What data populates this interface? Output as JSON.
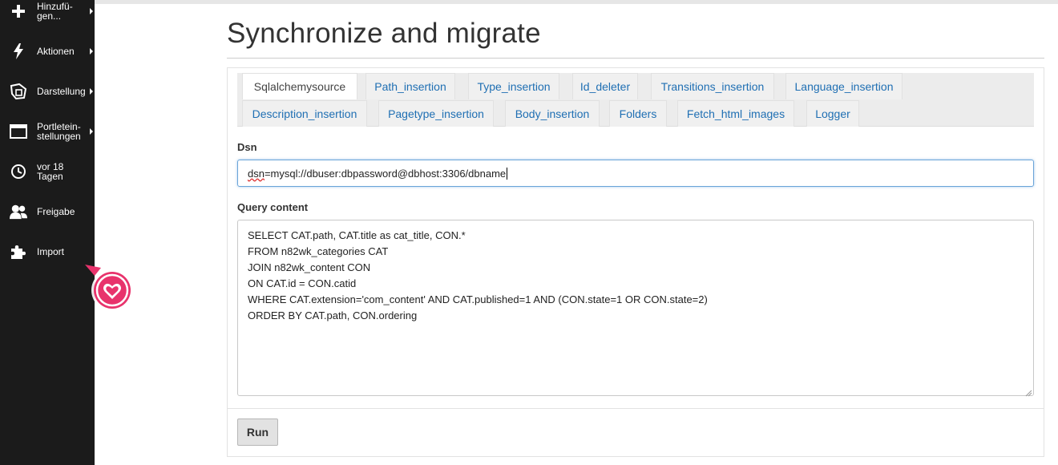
{
  "sidebar": {
    "items": [
      {
        "label": "Hinzufü-gen...",
        "icon": "plus-icon",
        "has_submenu": true
      },
      {
        "label": "Aktionen",
        "icon": "lightning-icon",
        "has_submenu": true
      },
      {
        "label": "Darstellung",
        "icon": "display-icon",
        "has_submenu": true
      },
      {
        "label": "Portletein-stellungen",
        "icon": "portlet-icon",
        "has_submenu": true
      },
      {
        "label": "vor 18 Tagen",
        "icon": "clock-icon",
        "has_submenu": false
      },
      {
        "label": "Freigabe",
        "icon": "users-icon",
        "has_submenu": false
      },
      {
        "label": "Import",
        "icon": "puzzle-icon",
        "has_submenu": false
      }
    ],
    "label_lines": {
      "hinzu": [
        "Hinzufü-",
        "gen..."
      ],
      "portlet": [
        "Portletein-",
        "stellungen"
      ],
      "vor": [
        "vor 18",
        "Tagen"
      ]
    }
  },
  "page": {
    "title": "Synchronize and migrate"
  },
  "tabs": [
    {
      "label": "Sqlalchemysource",
      "active": true
    },
    {
      "label": "Path_insertion",
      "active": false
    },
    {
      "label": "Type_insertion",
      "active": false
    },
    {
      "label": "Id_deleter",
      "active": false
    },
    {
      "label": "Transitions_insertion",
      "active": false
    },
    {
      "label": "Language_insertion",
      "active": false
    },
    {
      "label": "Description_insertion",
      "active": false
    },
    {
      "label": "Pagetype_insertion",
      "active": false
    },
    {
      "label": "Body_insertion",
      "active": false
    },
    {
      "label": "Folders",
      "active": false
    },
    {
      "label": "Fetch_html_images",
      "active": false
    },
    {
      "label": "Logger",
      "active": false
    }
  ],
  "form": {
    "dsn": {
      "label": "Dsn",
      "value_prefix": "dsn",
      "value_rest": "=mysql://dbuser:dbpassword@dbhost:3306/dbname"
    },
    "query": {
      "label": "Query content",
      "value": "SELECT CAT.path, CAT.title as cat_title, CON.*\nFROM n82wk_categories CAT\nJOIN n82wk_content CON\nON CAT.id = CON.catid\nWHERE CAT.extension='com_content' AND CAT.published=1 AND (CON.state=1 OR CON.state=2)\nORDER BY CAT.path, CON.ordering"
    },
    "run_label": "Run"
  },
  "colors": {
    "sidebar_bg": "#1b1b1b",
    "tab_link": "#1f6fb3",
    "heart_badge": "#e8336c"
  }
}
